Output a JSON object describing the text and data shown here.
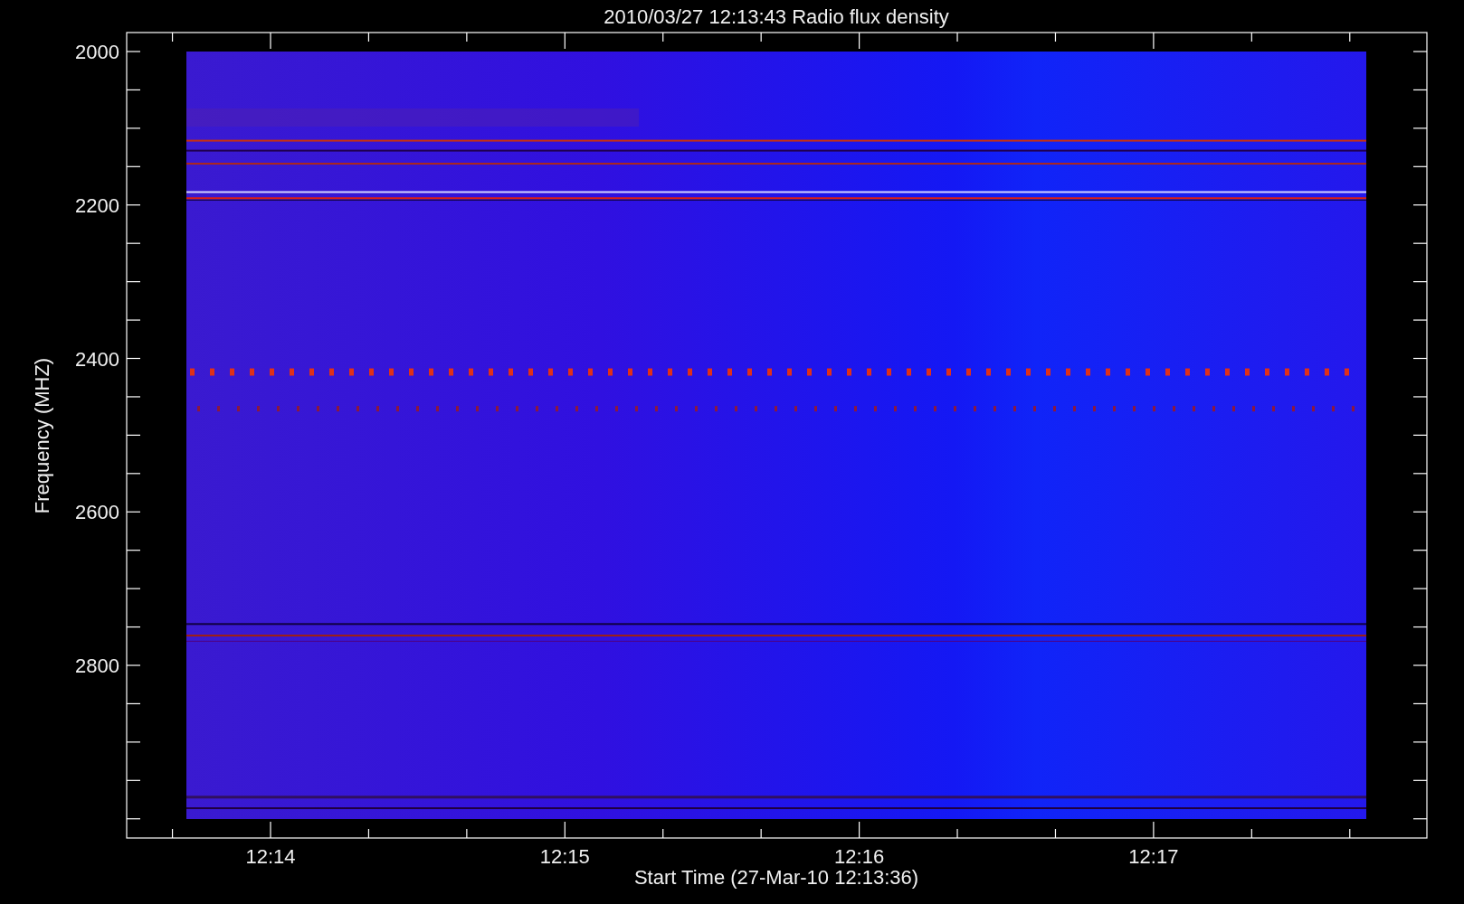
{
  "title": "2010/03/27 12:13:43 Radio flux density",
  "y_axis": {
    "label": "Frequency (MHZ)",
    "ticks": [
      "2000",
      "2200",
      "2400",
      "2600",
      "2800"
    ]
  },
  "x_axis": {
    "label": "Start Time (27-Mar-10 12:13:36)",
    "ticks": [
      "12:14",
      "12:15",
      "12:16",
      "12:17"
    ]
  }
}
